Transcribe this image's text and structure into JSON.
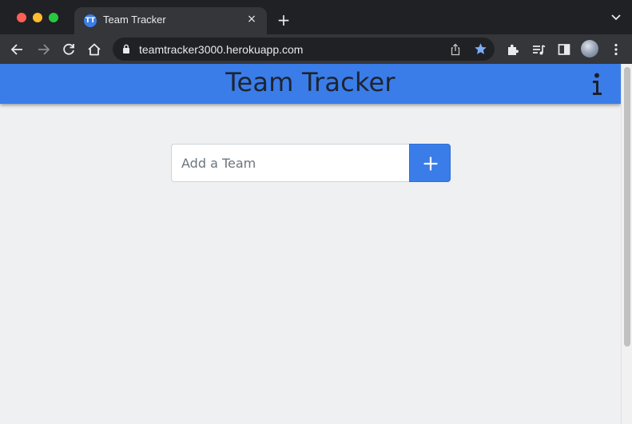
{
  "browser": {
    "tab": {
      "title": "Team Tracker",
      "favicon": "TT"
    },
    "new_tab_icon": "+",
    "close_icon": "×",
    "url": "teamtracker3000.herokuapp.com",
    "window_controls": [
      "close",
      "minimize",
      "maximize"
    ],
    "toolbar_icons": [
      "back-icon",
      "forward-icon",
      "reload-icon",
      "home-icon",
      "lock-icon",
      "share-icon",
      "bookmark-star-icon",
      "extensions-icon",
      "media-icon",
      "side-panel-icon",
      "profile-avatar",
      "menu-icon"
    ]
  },
  "app": {
    "title": "Team Tracker",
    "header_color": "#3a7de9",
    "info_icon": "i",
    "add_team": {
      "placeholder": "Add a Team",
      "value": "",
      "button_icon": "plus-icon"
    }
  }
}
